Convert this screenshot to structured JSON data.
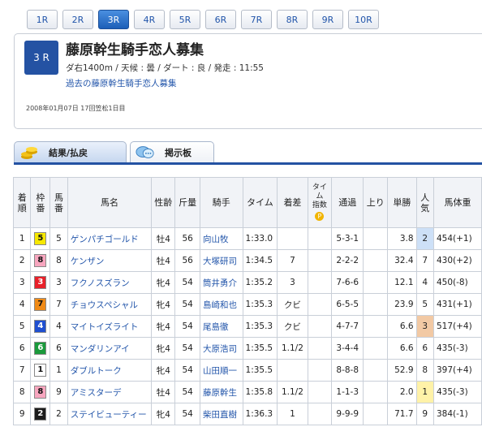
{
  "race_tabs": [
    {
      "label": "1R"
    },
    {
      "label": "2R"
    },
    {
      "label": "3R",
      "active": true
    },
    {
      "label": "4R"
    },
    {
      "label": "5R"
    },
    {
      "label": "6R"
    },
    {
      "label": "7R"
    },
    {
      "label": "8R"
    },
    {
      "label": "9R"
    },
    {
      "label": "10R"
    }
  ],
  "race": {
    "number_label": "3 R",
    "title": "藤原幹生騎手恋人募集",
    "conditions": "ダ右1400m / 天候 : 曇 / ダート : 良 / 発走 : 11:55",
    "past_link": "過去の藤原幹生騎手恋人募集",
    "meeting": "2008年01月07日 17回笠松1日目"
  },
  "tabs": {
    "results": "結果/払戻",
    "board": "掲示板"
  },
  "headers": {
    "order": "着\n順",
    "waku": "枠\n番",
    "umaban": "馬\n番",
    "name": "馬名",
    "sexage": "性齢",
    "weight": "斤量",
    "jockey": "騎手",
    "time": "タイム",
    "margin": "着差",
    "timeidx": "タイム\n指数",
    "timeidx_icon": "P",
    "passing": "通過",
    "last": "上り",
    "odds": "単勝",
    "pop": "人\n気",
    "bodyweight": "馬体重"
  },
  "colors": {
    "waku_1": "#ffffff",
    "waku_2": "#1c1c1c",
    "waku_3": "#e8202a",
    "waku_4": "#1f4fd0",
    "waku_5": "#f6e800",
    "waku_6": "#1a9a3c",
    "waku_7": "#f08a16",
    "waku_8": "#f7a6bf",
    "pop1": "#fff2a8",
    "pop2": "#cde0f7",
    "pop3": "#f2c9a4"
  },
  "rows": [
    {
      "order": "1",
      "waku": "5",
      "umaban": "5",
      "name": "ゲンパチゴールド",
      "sexage": "牡4",
      "weight": "56",
      "jockey": "向山牧",
      "time": "1:33.0",
      "margin": "",
      "passing": "5-3-1",
      "last": "",
      "odds": "3.8",
      "pop": "2",
      "bodyweight": "454(+1)"
    },
    {
      "order": "2",
      "waku": "8",
      "umaban": "8",
      "name": "ケンザン",
      "sexage": "牡4",
      "weight": "56",
      "jockey": "大塚研司",
      "time": "1:34.5",
      "margin": "7",
      "passing": "2-2-2",
      "last": "",
      "odds": "32.4",
      "pop": "7",
      "bodyweight": "430(+2)"
    },
    {
      "order": "3",
      "waku": "3",
      "umaban": "3",
      "name": "フクノスズラン",
      "sexage": "牝4",
      "weight": "54",
      "jockey": "筒井勇介",
      "time": "1:35.2",
      "margin": "3",
      "passing": "7-6-6",
      "last": "",
      "odds": "12.1",
      "pop": "4",
      "bodyweight": "450(-8)"
    },
    {
      "order": "4",
      "waku": "7",
      "umaban": "7",
      "name": "チョウスペシャル",
      "sexage": "牝4",
      "weight": "54",
      "jockey": "島崎和也",
      "time": "1:35.3",
      "margin": "クビ",
      "passing": "6-5-5",
      "last": "",
      "odds": "23.9",
      "pop": "5",
      "bodyweight": "431(+1)"
    },
    {
      "order": "5",
      "waku": "4",
      "umaban": "4",
      "name": "マイトイズライト",
      "sexage": "牝4",
      "weight": "54",
      "jockey": "尾島徹",
      "time": "1:35.3",
      "margin": "クビ",
      "passing": "4-7-7",
      "last": "",
      "odds": "6.6",
      "pop": "3",
      "bodyweight": "517(+4)"
    },
    {
      "order": "6",
      "waku": "6",
      "umaban": "6",
      "name": "マンダリンアイ",
      "sexage": "牝4",
      "weight": "54",
      "jockey": "大原浩司",
      "time": "1:35.5",
      "margin": "1.1/2",
      "passing": "3-4-4",
      "last": "",
      "odds": "6.6",
      "pop": "6",
      "bodyweight": "435(-3)"
    },
    {
      "order": "7",
      "waku": "1",
      "umaban": "1",
      "name": "ダブルトーク",
      "sexage": "牝4",
      "weight": "54",
      "jockey": "山田順一",
      "time": "1:35.5",
      "margin": "",
      "passing": "8-8-8",
      "last": "",
      "odds": "52.9",
      "pop": "8",
      "bodyweight": "397(+4)"
    },
    {
      "order": "8",
      "waku": "8",
      "umaban": "9",
      "name": "アミスターデ",
      "sexage": "牡4",
      "weight": "54",
      "jockey": "藤原幹生",
      "time": "1:35.8",
      "margin": "1.1/2",
      "passing": "1-1-3",
      "last": "",
      "odds": "2.0",
      "pop": "1",
      "bodyweight": "435(-3)"
    },
    {
      "order": "9",
      "waku": "2",
      "umaban": "2",
      "name": "ステイビューティー",
      "sexage": "牝4",
      "weight": "54",
      "jockey": "柴田直樹",
      "time": "1:36.3",
      "margin": "1",
      "passing": "9-9-9",
      "last": "",
      "odds": "71.7",
      "pop": "9",
      "bodyweight": "384(-1)"
    }
  ]
}
